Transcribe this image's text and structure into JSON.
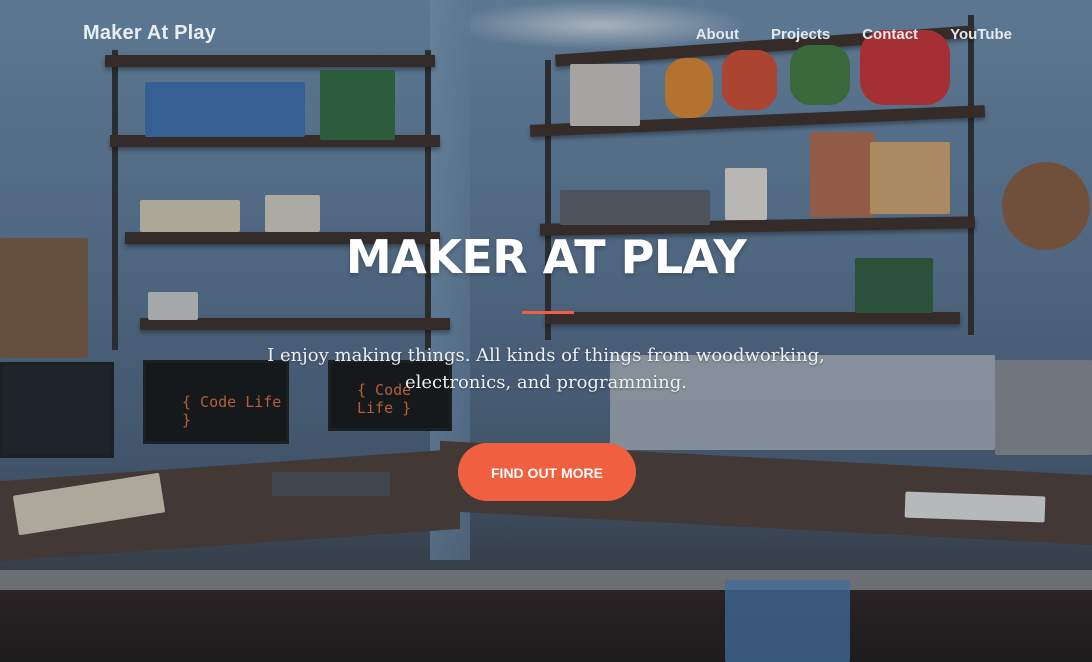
{
  "nav": {
    "brand": "Maker At Play",
    "links": [
      {
        "label": "About"
      },
      {
        "label": "Projects"
      },
      {
        "label": "Contact"
      },
      {
        "label": "YouTube"
      }
    ]
  },
  "hero": {
    "title": "MAKER AT PLAY",
    "subtitle": "I enjoy making things. All kinds of things from woodworking, electronics, and programming.",
    "cta_label": "FIND OUT MORE"
  },
  "background": {
    "monitor_text": "{ Code Life }"
  },
  "colors": {
    "accent": "#f05f40",
    "text_light": "#ffffff"
  }
}
